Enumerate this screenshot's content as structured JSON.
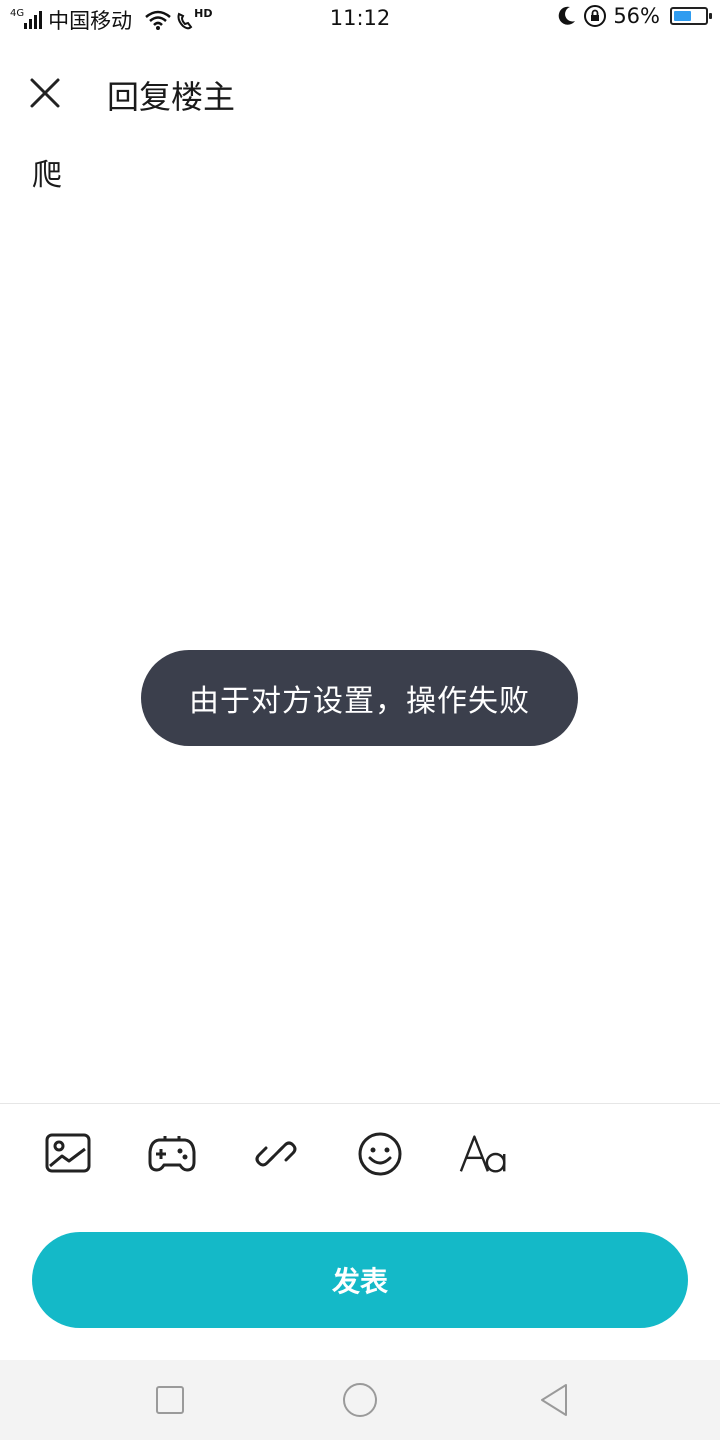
{
  "status_bar": {
    "network_type": "4G",
    "carrier": "中国移动",
    "hd_label": "HD",
    "time": "11:12",
    "battery_percent_text": "56%",
    "battery_level": 0.56
  },
  "header": {
    "title": "回复楼主"
  },
  "editor": {
    "text": "爬"
  },
  "toast": {
    "message": "由于对方设置，操作失败"
  },
  "toolbar": {
    "items": [
      {
        "icon": "image-icon"
      },
      {
        "icon": "gamepad-icon"
      },
      {
        "icon": "link-icon"
      },
      {
        "icon": "emoji-icon"
      },
      {
        "icon": "font-style-icon"
      }
    ]
  },
  "publish_button": {
    "label": "发表",
    "color": "#14b9c8"
  },
  "nav_bar": {
    "items": [
      "recent-apps-icon",
      "home-icon",
      "back-icon"
    ]
  }
}
